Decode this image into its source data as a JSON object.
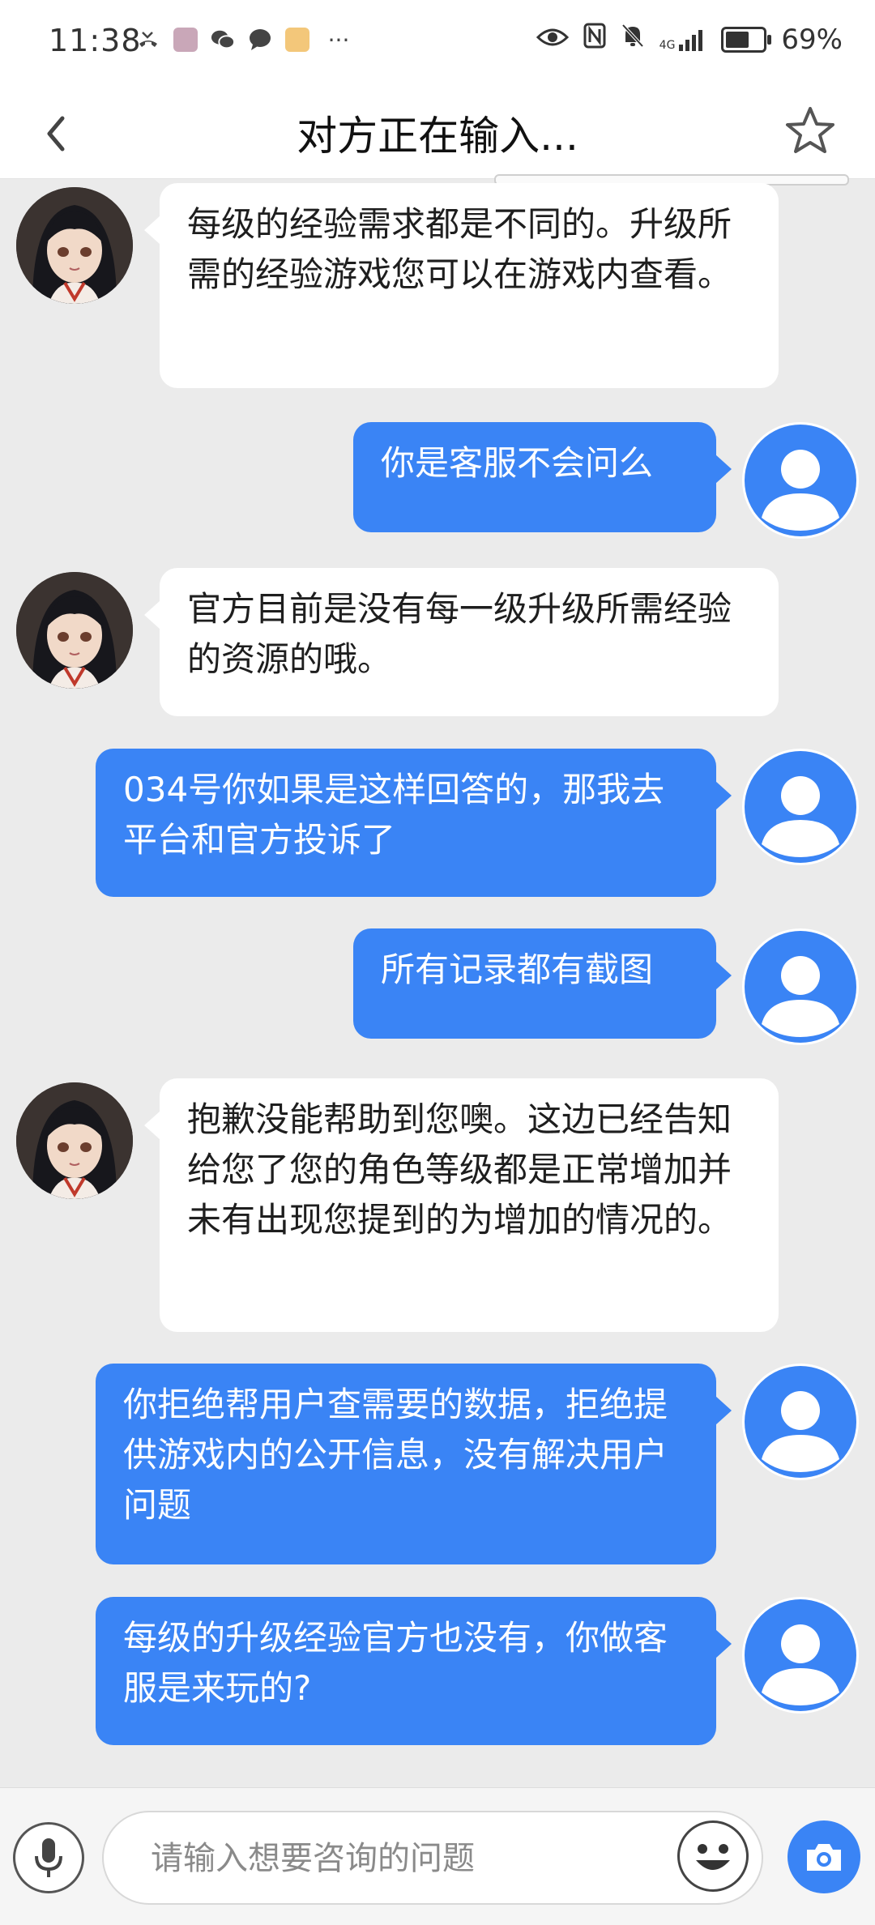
{
  "status_bar": {
    "time": "11:38",
    "more": "···",
    "network": "4G",
    "battery": "69%",
    "battery_level": 0.69
  },
  "nav": {
    "title": "对方正在输入..."
  },
  "messages": [
    {
      "sender": "agent",
      "text": "每级的经验需求都是不同的。升级所需的经验游戏您可以在游戏内查看。"
    },
    {
      "sender": "user",
      "text": "你是客服不会问么"
    },
    {
      "sender": "agent",
      "text": "官方目前是没有每一级升级所需经验的资源的哦。"
    },
    {
      "sender": "user",
      "text": "034号你如果是这样回答的，那我去平台和官方投诉了"
    },
    {
      "sender": "user",
      "text": "所有记录都有截图"
    },
    {
      "sender": "agent",
      "text": "抱歉没能帮助到您噢。这边已经告知给您了您的角色等级都是正常增加并未有出现您提到的为增加的情况的。"
    },
    {
      "sender": "user",
      "text": "你拒绝帮用户查需要的数据，拒绝提供游戏内的公开信息，没有解决用户问题"
    },
    {
      "sender": "user",
      "text": "每级的升级经验官方也没有，你做客服是来玩的?"
    }
  ],
  "input": {
    "placeholder": "请输入想要咨询的问题"
  },
  "colors": {
    "accent": "#3a84f5",
    "background": "#ebebeb"
  }
}
